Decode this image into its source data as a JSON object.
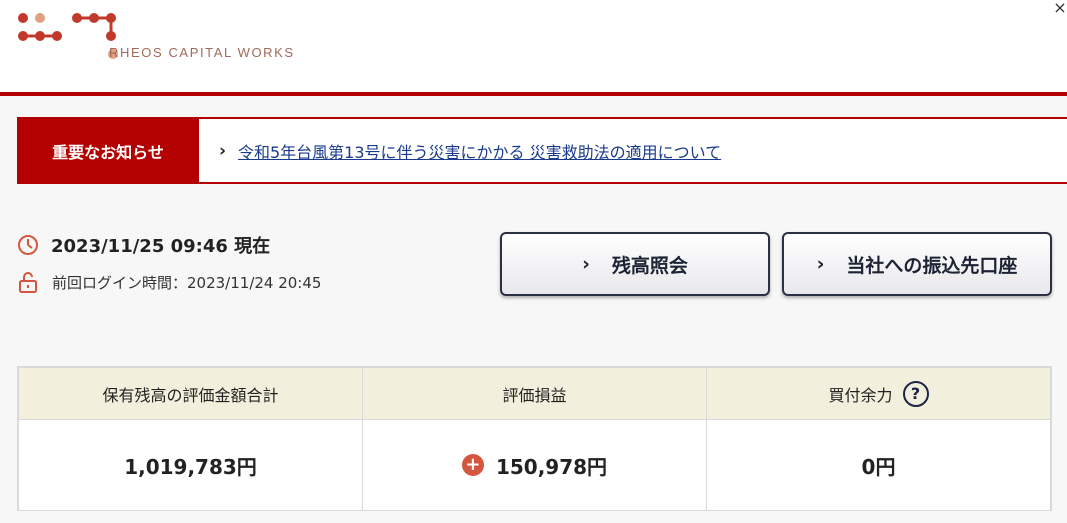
{
  "header": {
    "logo_text": "RHEOS CAPITAL WORKS",
    "close_glyph": "×",
    "brand_color": "#b30000"
  },
  "notice": {
    "label": "重要なお知らせ",
    "chevron": "›",
    "link_text": "令和5年台風第13号に伴う災害にかかる 災害救助法の適用について"
  },
  "status": {
    "datetime": "2023/11/25 09:46 現在",
    "last_login": "前回ログイン時間：2023/11/24 20:45",
    "clock_icon": "clock-icon",
    "lock_icon": "unlock-icon"
  },
  "actions": {
    "balance_label": "残高照会",
    "transfer_label": "当社への振込先口座",
    "chevron": "›"
  },
  "summary": {
    "headers": [
      "保有残高の評価金額合計",
      "評価損益",
      "買付余力"
    ],
    "values": [
      "1,019,783円",
      "150,978円",
      "0円"
    ],
    "help_glyph": "?",
    "plus_glyph": "+"
  }
}
